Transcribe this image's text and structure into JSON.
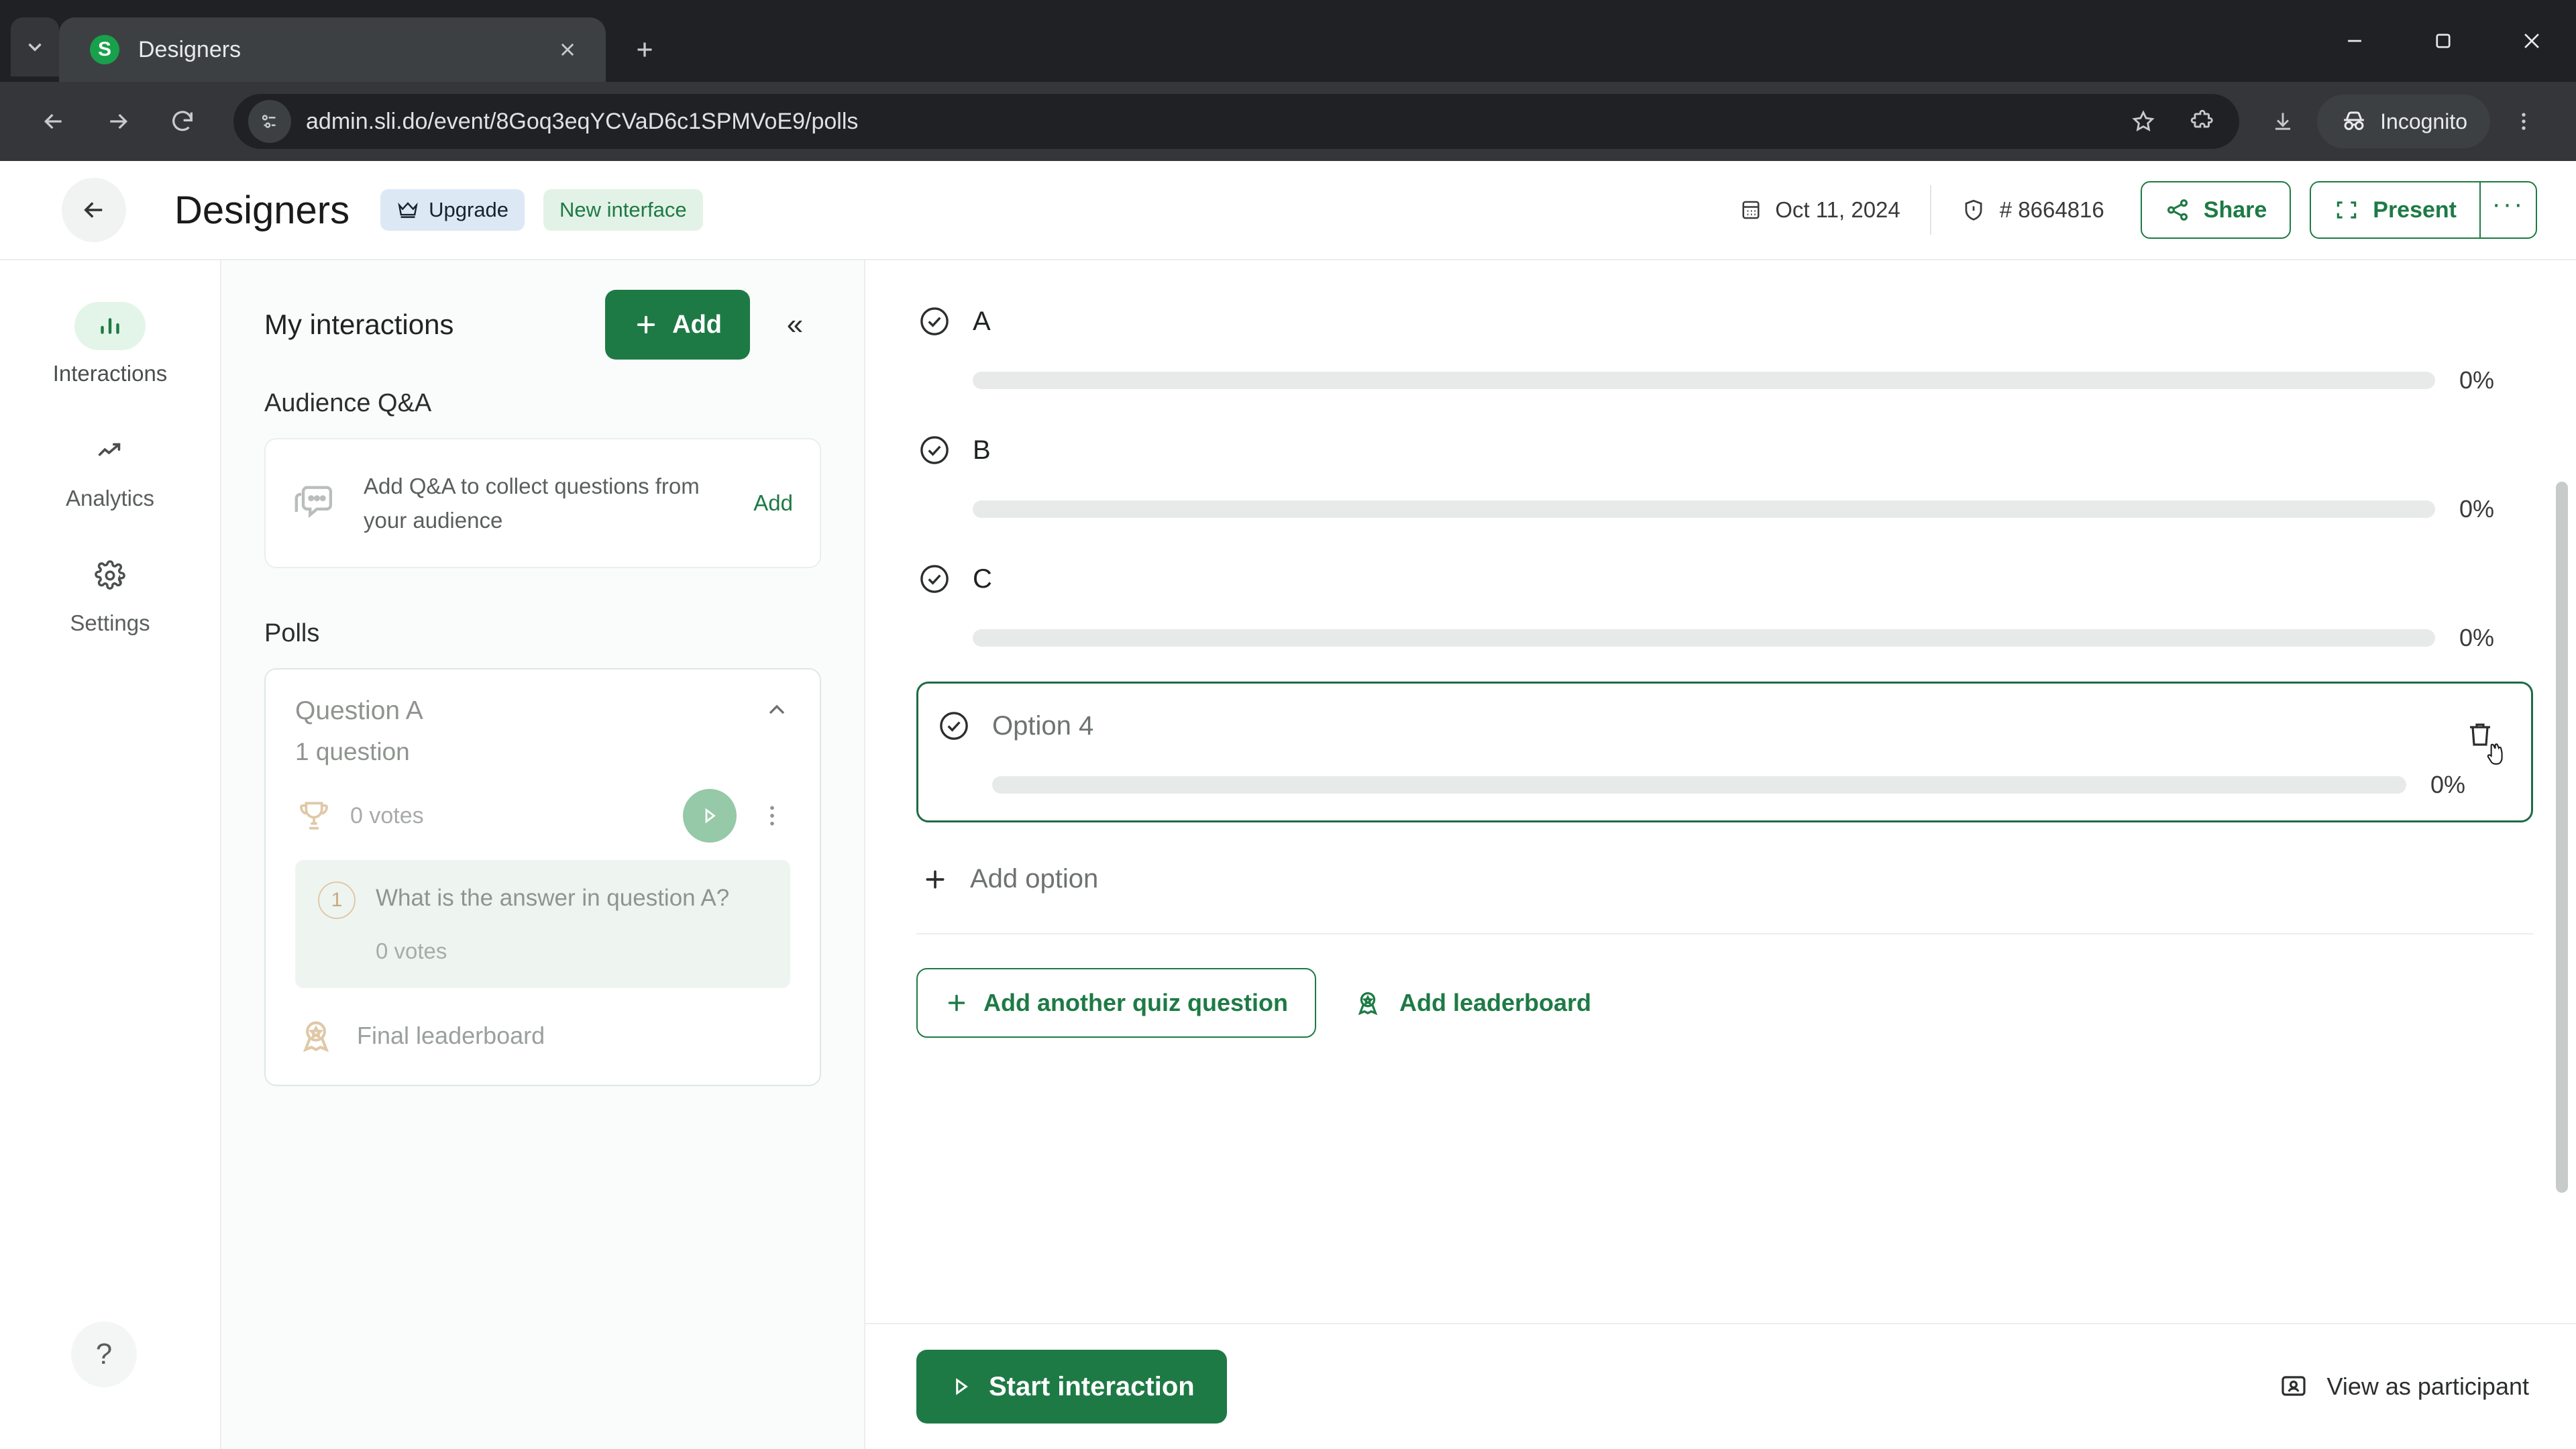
{
  "browser": {
    "tab": {
      "title": "Designers",
      "favicon_letter": "S",
      "favicon_color": "#19a04b"
    },
    "new_tab_label": "+",
    "url": "admin.sli.do/event/8Goq3eqYCVaD6c1SPMVoE9/polls",
    "profile_label": "Incognito"
  },
  "header": {
    "title": "Designers",
    "upgrade_badge": "Upgrade",
    "new_interface_badge": "New interface",
    "date": "Oct 11, 2024",
    "event_code": "# 8664816",
    "share_label": "Share",
    "present_label": "Present",
    "more_label": "···"
  },
  "rail": {
    "items": [
      {
        "label": "Interactions",
        "icon": "bar-chart-icon",
        "active": true
      },
      {
        "label": "Analytics",
        "icon": "trending-up-icon",
        "active": false
      },
      {
        "label": "Settings",
        "icon": "gear-icon",
        "active": false
      }
    ],
    "help_label": "?"
  },
  "list_panel": {
    "title": "My interactions",
    "add_label": "Add",
    "collapse_label": "«",
    "qa_section_title": "Audience Q&A",
    "qa_card": {
      "text": "Add Q&A to collect questions from your audience",
      "action_label": "Add"
    },
    "polls_section_title": "Polls",
    "poll": {
      "name": "Question A",
      "subtitle": "1 question",
      "votes": "0 votes",
      "question_number": "1",
      "question_text": "What is the answer in question A?",
      "question_votes": "0 votes",
      "leaderboard_label": "Final leaderboard"
    }
  },
  "main": {
    "options": [
      {
        "label": "A",
        "percent": "0%",
        "focused": false
      },
      {
        "label": "B",
        "percent": "0%",
        "focused": false
      },
      {
        "label": "C",
        "percent": "0%",
        "focused": false
      },
      {
        "label": "Option 4",
        "percent": "0%",
        "focused": true
      }
    ],
    "add_option_label": "Add option",
    "add_quiz_question_label": "Add another quiz question",
    "add_leaderboard_label": "Add leaderboard",
    "start_interaction_label": "Start interaction",
    "view_as_participant_label": "View as participant"
  },
  "colors": {
    "brand_green": "#1e7a45",
    "badge_blue": "#dce9f5",
    "badge_green": "#e3f2e7",
    "focus_border": "#1e6b46"
  }
}
